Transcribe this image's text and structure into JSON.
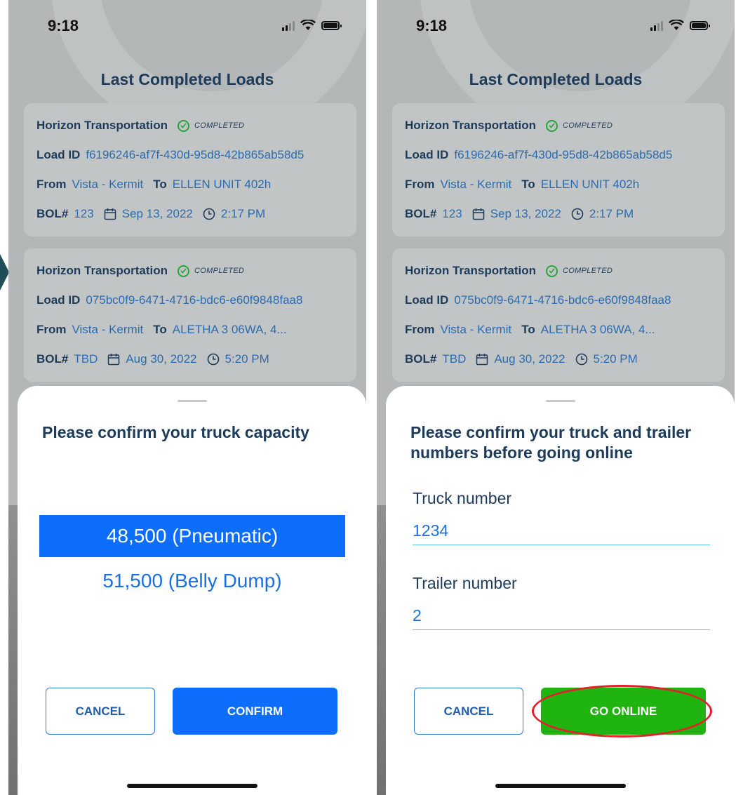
{
  "status_bar": {
    "time": "9:18"
  },
  "screen": {
    "title": "Last Completed Loads"
  },
  "loads": [
    {
      "company": "Horizon Transportation",
      "status": "COMPLETED",
      "load_id_label": "Load ID",
      "load_id": "f6196246-af7f-430d-95d8-42b865ab58d5",
      "from_label": "From",
      "from": "Vista - Kermit",
      "to_label": "To",
      "to": "ELLEN UNIT 402h",
      "bol_label": "BOL#",
      "bol": "123",
      "date": "Sep 13, 2022",
      "time": "2:17 PM"
    },
    {
      "company": "Horizon Transportation",
      "status": "COMPLETED",
      "load_id_label": "Load ID",
      "load_id": "075bc0f9-6471-4716-bdc6-e60f9848faa8",
      "from_label": "From",
      "from": "Vista - Kermit",
      "to_label": "To",
      "to": "ALETHA 3 06WA, 4...",
      "bol_label": "BOL#",
      "bol": "TBD",
      "date": "Aug 30, 2022",
      "time": "5:20 PM"
    }
  ],
  "capacity_sheet": {
    "title": "Please confirm your truck capacity",
    "options": [
      "48,500 (Pneumatic)",
      "51,500 (Belly Dump)"
    ],
    "selected": "48,500 (Pneumatic)",
    "cancel_label": "CANCEL",
    "confirm_label": "CONFIRM"
  },
  "truck_sheet": {
    "title": "Please confirm your truck and trailer numbers before going online",
    "truck_label": "Truck number",
    "truck_value": "1234",
    "trailer_label": "Trailer number",
    "trailer_value": "2",
    "cancel_label": "CANCEL",
    "go_online_label": "GO ONLINE"
  },
  "colors": {
    "primary": "#0d6efd",
    "go_online": "#1fb40f",
    "highlight": "#e3212b",
    "heading": "#1d3b5a"
  }
}
